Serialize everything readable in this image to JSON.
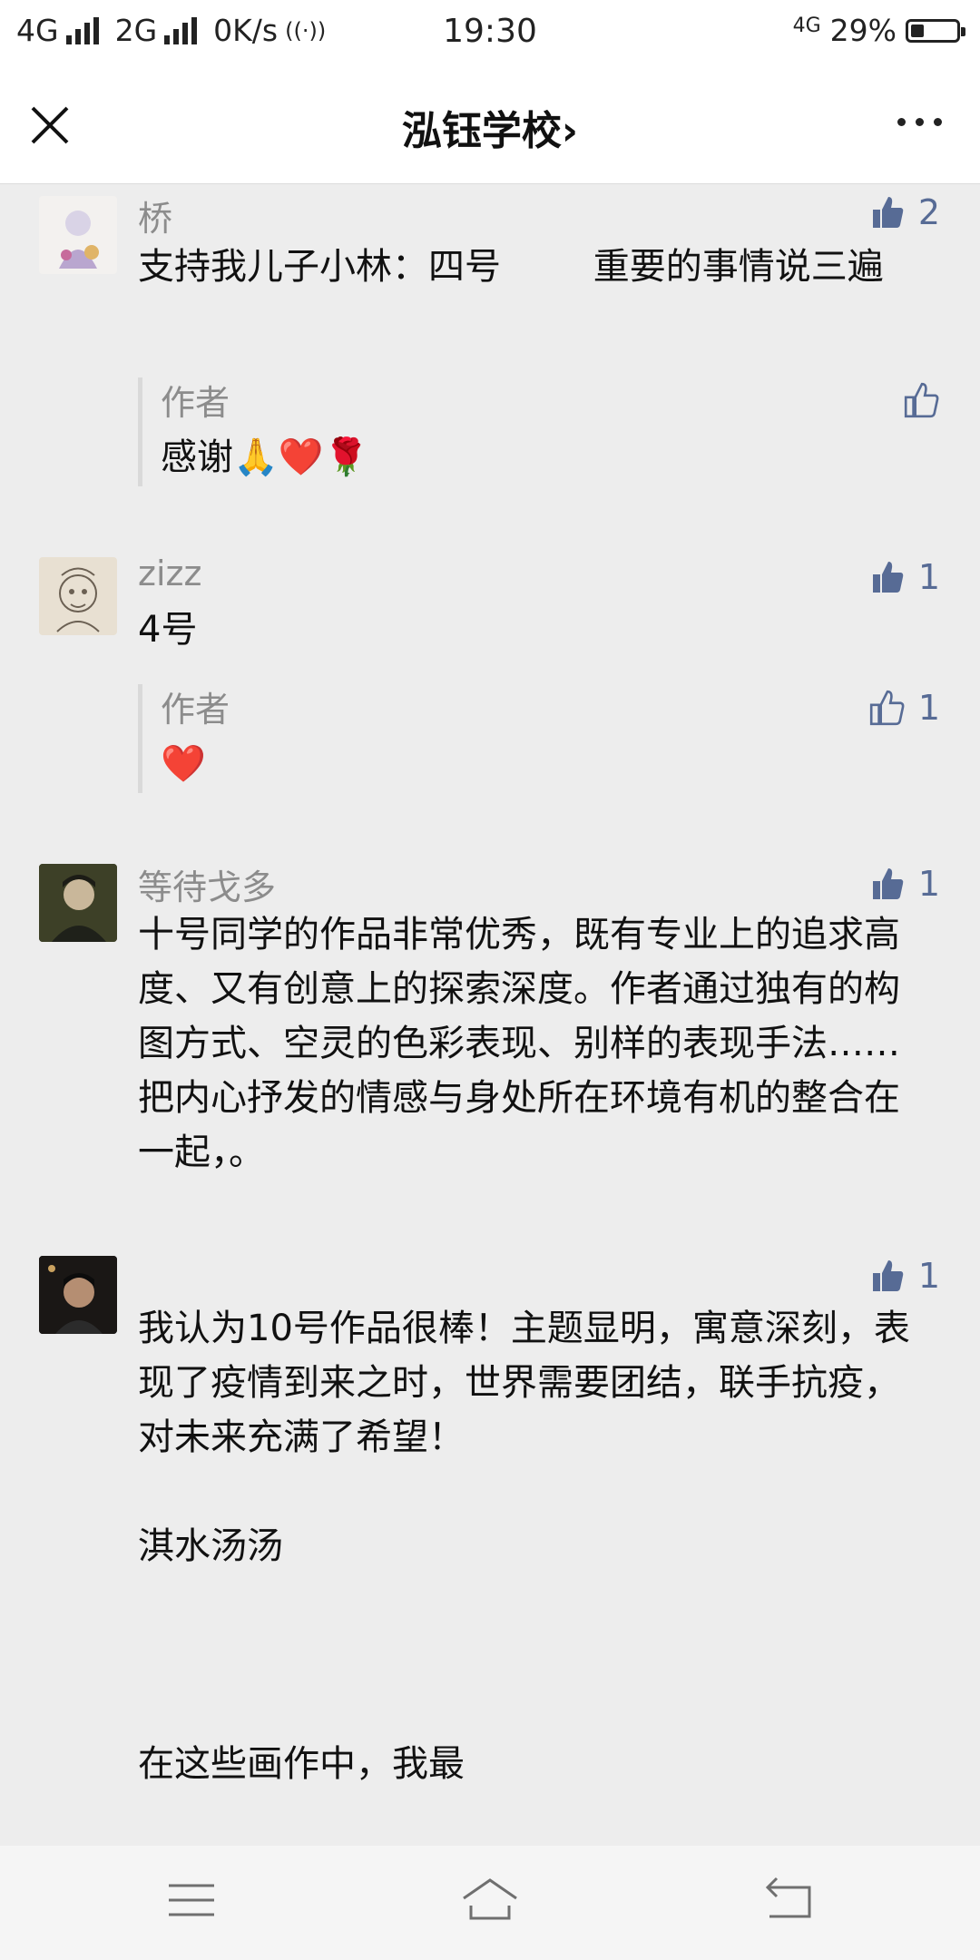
{
  "status_bar": {
    "network1": "4G",
    "network2": "2G",
    "speed": "0K/s",
    "time": "19:30",
    "network_right": "4G",
    "battery_text": "29%",
    "battery_level": 0.29
  },
  "nav": {
    "title": "泓钰学校",
    "title_chevron": "›"
  },
  "comments": [
    {
      "name": "桥",
      "text": "支持我儿子小林：四号        重要的事情说三遍",
      "likes": "2",
      "reply": {
        "name": "作者",
        "text": "感谢🙏❤️🌹",
        "likes": ""
      }
    },
    {
      "name": "zizz",
      "text": "4号",
      "likes": "1",
      "reply": {
        "name": "作者",
        "text": "❤️",
        "likes": "1"
      }
    },
    {
      "name": "等待戈多",
      "text": "十号同学的作品非常优秀，既有专业上的追求高度、又有创意上的探索深度。作者通过独有的构图方式、空灵的色彩表现、别样的表现手法……把内心抒发的情感与身处所在环境有机的整合在一起，。",
      "likes": "1"
    },
    {
      "name": "",
      "text": "我认为10号作品很棒！主题显明，寓意深刻，表现了疫情到来之时，世界需要团结，联手抗疫，对未来充满了希望！",
      "text2": "淇水汤汤",
      "text3": "在这些画作中，我最",
      "likes": "1"
    }
  ],
  "icons": {
    "close": "close-icon",
    "more": "more-icon",
    "like": "thumbs-up-icon",
    "menu": "menu-icon",
    "home": "home-icon",
    "back": "back-icon"
  },
  "colors": {
    "like_blue": "#576b95",
    "background": "#ededed"
  }
}
